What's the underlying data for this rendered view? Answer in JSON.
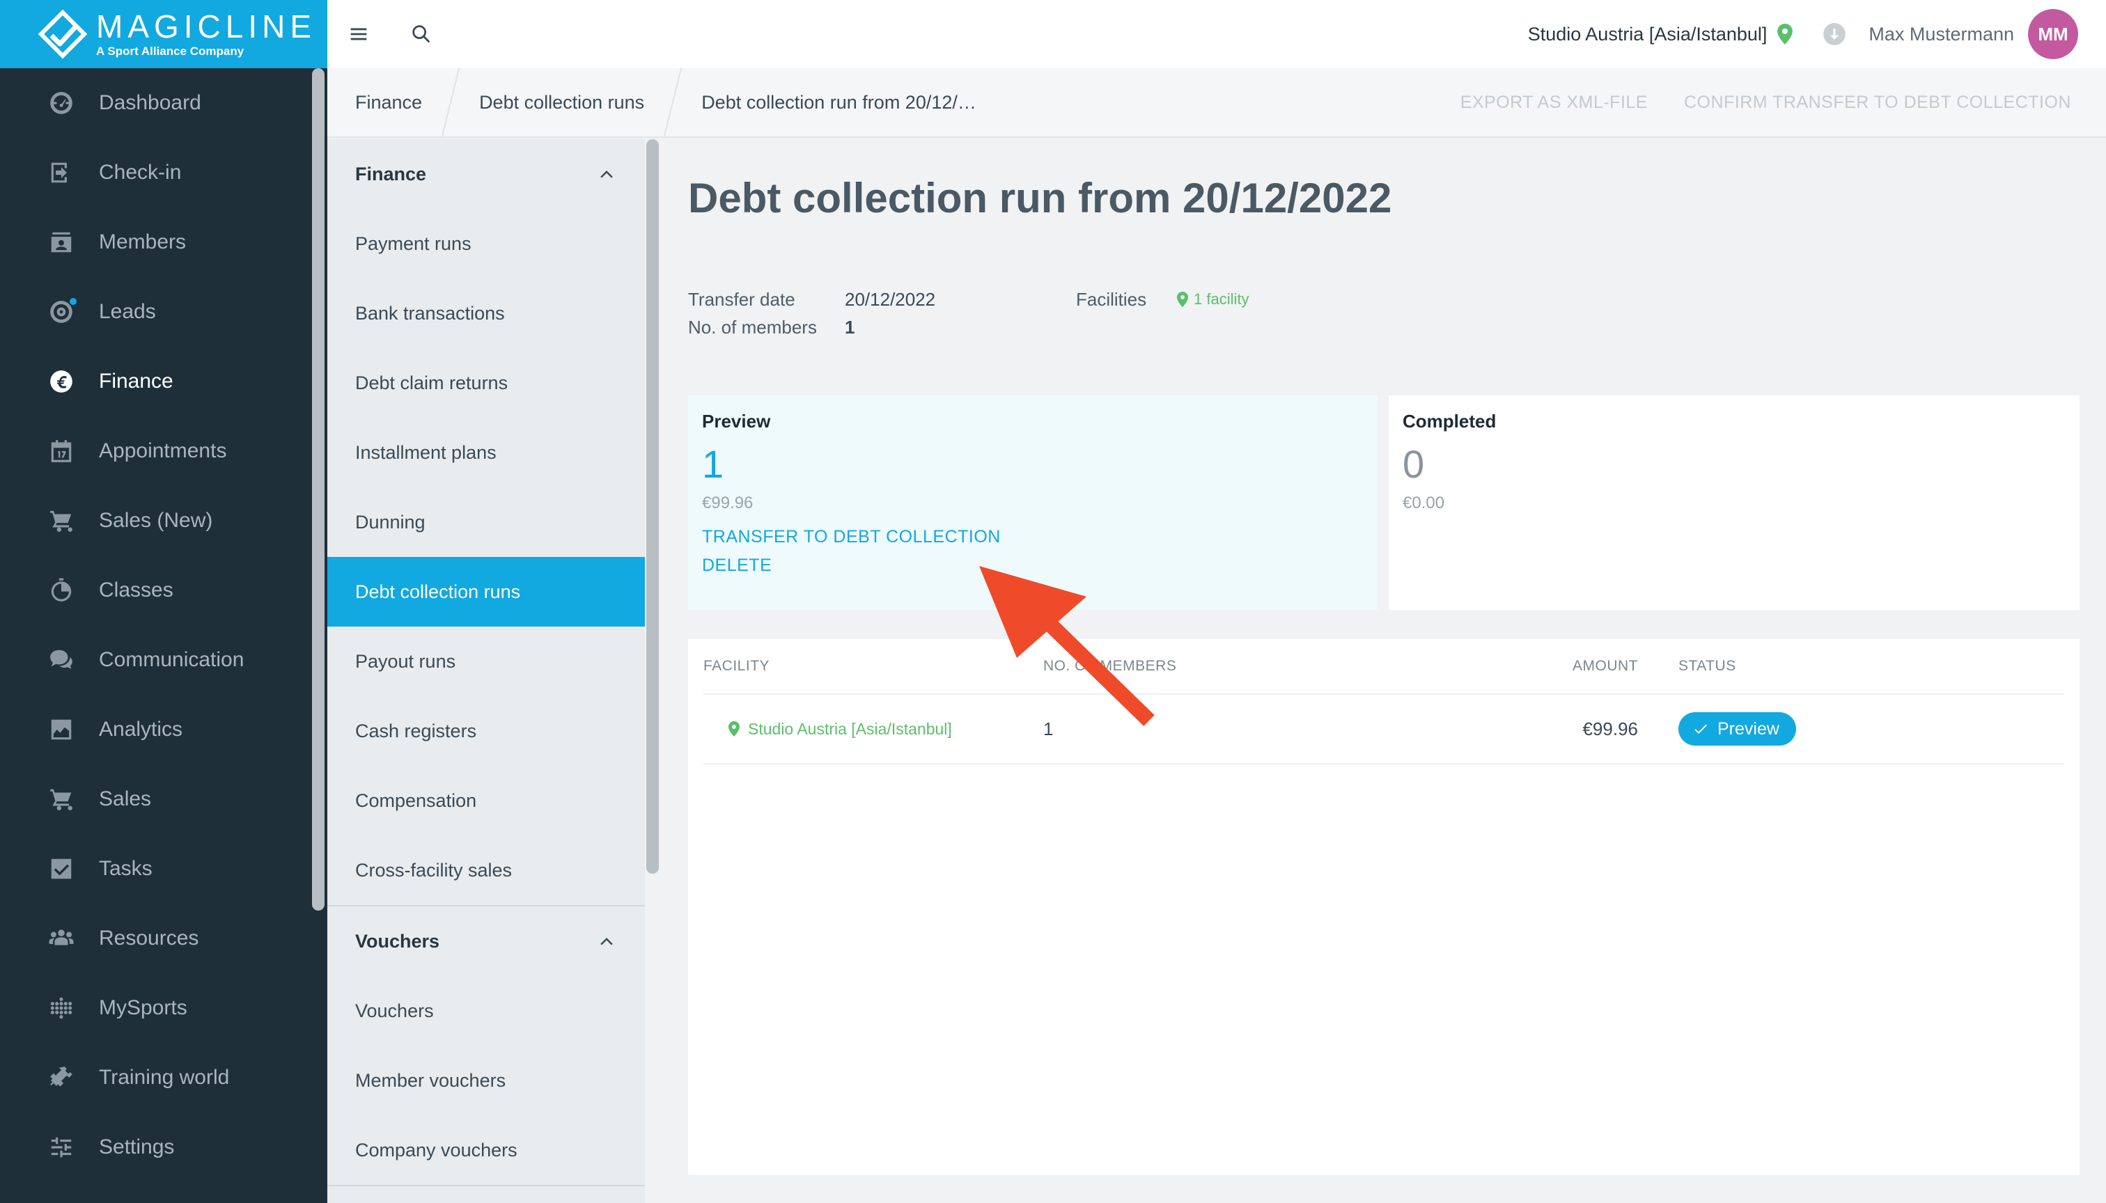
{
  "brand": {
    "name": "MAGICLINE",
    "tagline": "A Sport Alliance Company"
  },
  "sidebar": {
    "items": [
      {
        "label": "Dashboard",
        "icon": "dashboard-icon"
      },
      {
        "label": "Check-in",
        "icon": "check-in-icon"
      },
      {
        "label": "Members",
        "icon": "members-icon"
      },
      {
        "label": "Leads",
        "icon": "leads-icon"
      },
      {
        "label": "Finance",
        "icon": "euro-icon"
      },
      {
        "label": "Appointments",
        "icon": "calendar-icon"
      },
      {
        "label": "Sales (New)",
        "icon": "cart-icon"
      },
      {
        "label": "Classes",
        "icon": "timer-icon"
      },
      {
        "label": "Communication",
        "icon": "chat-icon"
      },
      {
        "label": "Analytics",
        "icon": "chart-icon"
      },
      {
        "label": "Sales",
        "icon": "cart-icon"
      },
      {
        "label": "Tasks",
        "icon": "checkbox-icon"
      },
      {
        "label": "Resources",
        "icon": "people-icon"
      },
      {
        "label": "MySports",
        "icon": "dots-grid-icon"
      },
      {
        "label": "Training world",
        "icon": "dumbbell-icon"
      },
      {
        "label": "Settings",
        "icon": "sliders-icon"
      }
    ]
  },
  "topbar": {
    "studio": "Studio Austria [Asia/Istanbul]",
    "user_name": "Max Mustermann",
    "avatar_initials": "MM"
  },
  "breadcrumb": {
    "items": [
      "Finance",
      "Debt collection runs",
      "Debt collection run from 20/12/…"
    ],
    "actions": [
      "EXPORT AS XML-FILE",
      "CONFIRM TRANSFER TO DEBT COLLECTION"
    ]
  },
  "subnav": {
    "finance_title": "Finance",
    "finance_items": [
      "Payment runs",
      "Bank transactions",
      "Debt claim returns",
      "Installment plans",
      "Dunning",
      "Debt collection runs",
      "Payout runs",
      "Cash registers",
      "Compensation",
      "Cross-facility sales"
    ],
    "vouchers_title": "Vouchers",
    "voucher_items": [
      "Vouchers",
      "Member vouchers",
      "Company vouchers"
    ]
  },
  "main": {
    "title": "Debt collection run from 20/12/2022",
    "transfer_date_label": "Transfer date",
    "transfer_date": "20/12/2022",
    "members_label": "No. of members",
    "members": "1",
    "facilities_label": "Facilities",
    "facilities_value": "1 facility",
    "preview": {
      "title": "Preview",
      "count": "1",
      "amount": "€99.96",
      "transfer_link": "TRANSFER TO DEBT COLLECTION",
      "delete_link": "DELETE"
    },
    "completed": {
      "title": "Completed",
      "count": "0",
      "amount": "€0.00"
    },
    "table": {
      "headers": [
        "FACILITY",
        "NO. OF MEMBERS",
        "AMOUNT",
        "STATUS"
      ],
      "rows": [
        {
          "facility": "Studio Austria [Asia/Istanbul]",
          "members": "1",
          "amount": "€99.96",
          "status": "Preview"
        }
      ]
    }
  },
  "colors": {
    "accent": "#12a8e0",
    "sidebar_bg": "#1e2f3a",
    "green": "#5cbf6a",
    "annotation_arrow": "#ef4a2a"
  }
}
